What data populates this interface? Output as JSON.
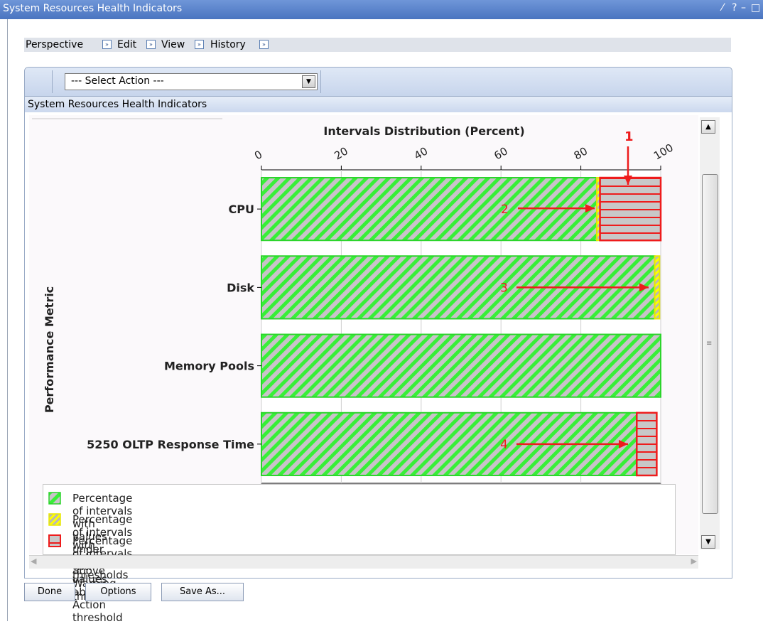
{
  "window": {
    "title": "System Resources Health Indicators",
    "controls": [
      "⁄",
      "?",
      "–",
      "□"
    ]
  },
  "nav": {
    "items": [
      {
        "label": "Perspective"
      },
      {
        "label": "Edit"
      },
      {
        "label": "View"
      },
      {
        "label": "History"
      }
    ]
  },
  "toolbar": {
    "select_action": "--- Select Action ---"
  },
  "section_title": "System Resources Health Indicators",
  "chart_data": {
    "type": "bar",
    "orientation": "horizontal",
    "stacked": true,
    "title": "Intervals Distribution (Percent)",
    "xlabel": "",
    "ylabel": "Performance Metric",
    "xlim": [
      0,
      100
    ],
    "xticks": [
      "0",
      "20",
      "40",
      "60",
      "80",
      "100"
    ],
    "categories": [
      "CPU",
      "Disk",
      "Memory Pools",
      "5250 OLTP Response Time"
    ],
    "series": [
      {
        "name": "Percentage of intervals with values under defined thresholds",
        "color": "#32ee32",
        "values": [
          84,
          98.5,
          100,
          94
        ]
      },
      {
        "name": "Percentage of intervals with values above Warning threshold",
        "color": "#ffff00",
        "values": [
          0.8,
          1.2,
          0,
          0
        ]
      },
      {
        "name": "Percentage of intervals with values above Action threshold",
        "color": "#ee1c1c",
        "values": [
          15.2,
          0,
          0,
          5
        ]
      }
    ],
    "annotations": [
      "1",
      "2",
      "3",
      "4"
    ]
  },
  "buttons": {
    "done": "Done",
    "options": "Options",
    "save_as": "Save As..."
  }
}
